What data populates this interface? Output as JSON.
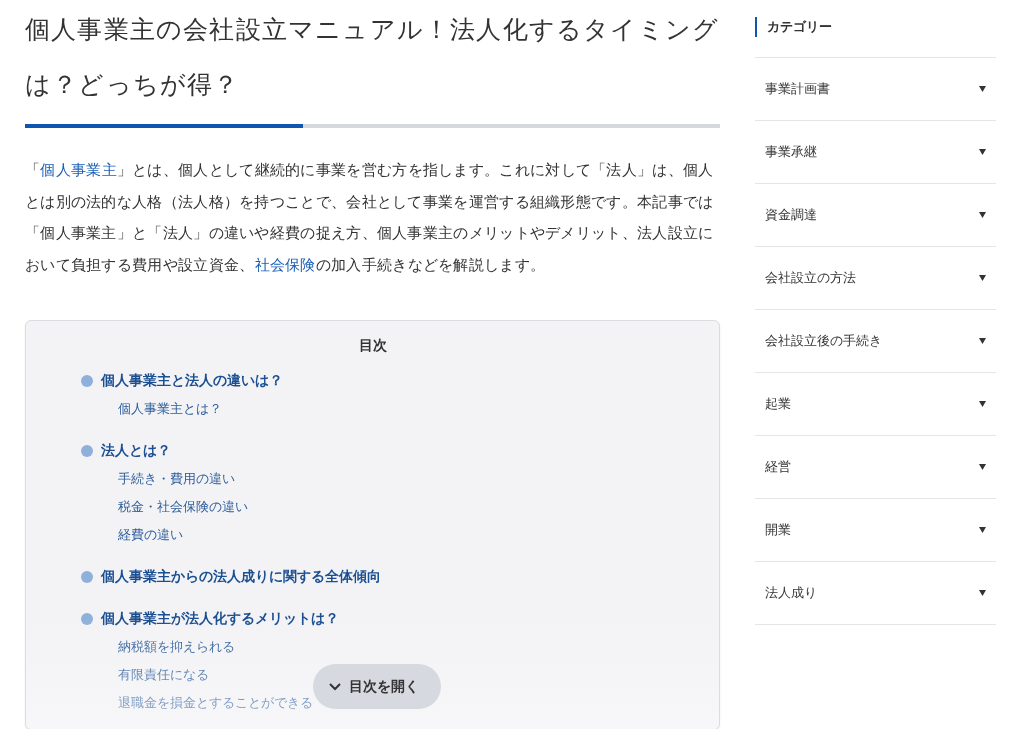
{
  "article": {
    "title": "個人事業主の会社設立マニュアル！法人化するタイミングは？どっちが得？",
    "progress": {
      "level": 0.4
    },
    "intro": [
      {
        "text": "「",
        "kind": "text"
      },
      {
        "text": "個人事業主",
        "kind": "link"
      },
      {
        "text": "」とは、個人として継続的に事業を営む方を指します。これに対して「法人」は、個人とは別の法的な人格（法人格）を持つことで、会社として事業を運営する組織形態です。本記事では「個人事業主」と「法人」の違いや経費の捉え方、個人事業主のメリットやデメリット、法人設立において負担する費用や設立資金、",
        "kind": "text"
      },
      {
        "text": "社会保険",
        "kind": "link"
      },
      {
        "text": "の加入手続きなどを解説します。",
        "kind": "text"
      }
    ],
    "toc": {
      "title": "目次",
      "expand_button": "目次を開く",
      "sections": [
        {
          "label": "個人事業主と法人の違いは？",
          "children": [
            {
              "label": "個人事業主とは？"
            }
          ]
        },
        {
          "label": "法人とは？",
          "children": [
            {
              "label": "手続き・費用の違い"
            },
            {
              "label": "税金・社会保険の違い"
            },
            {
              "label": "経費の違い"
            }
          ]
        },
        {
          "label": "個人事業主からの法人成りに関する全体傾向"
        },
        {
          "label": "個人事業主が法人化するメリットは？",
          "children": [
            {
              "label": "納税額を抑えられる"
            },
            {
              "label": "有限責任になる"
            },
            {
              "label": "退職金を損金とすることができる"
            }
          ]
        }
      ]
    }
  },
  "sidebar": {
    "heading": "カテゴリー",
    "items": [
      {
        "label": "事業計画書",
        "expanded": false
      },
      {
        "label": "事業承継",
        "expanded": false
      },
      {
        "label": "資金調達",
        "expanded": false
      },
      {
        "label": "会社設立の方法",
        "expanded": false
      },
      {
        "label": "会社設立後の手続き",
        "expanded": false
      },
      {
        "label": "起業",
        "expanded": false
      },
      {
        "label": "経営",
        "expanded": false
      },
      {
        "label": "開業",
        "expanded": false
      },
      {
        "label": "法人成り",
        "expanded": false
      }
    ]
  }
}
